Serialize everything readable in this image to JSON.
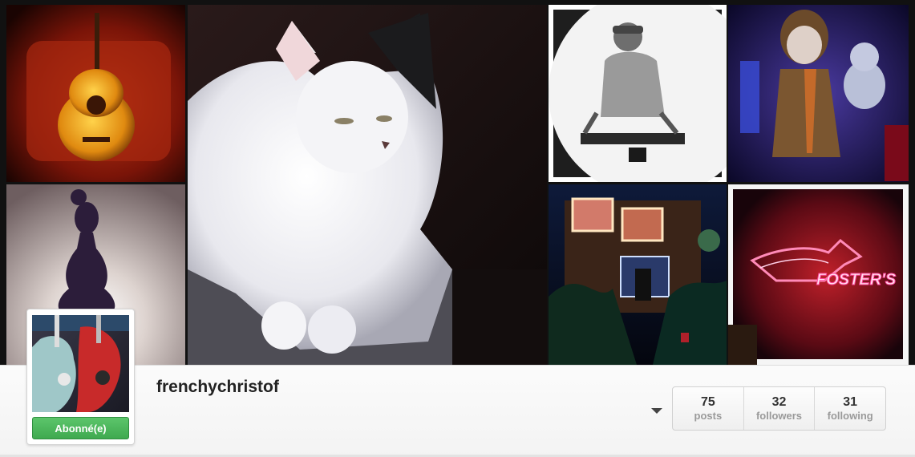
{
  "profile": {
    "username": "frenchychristof",
    "follow_button": "Abonné(e)"
  },
  "stats": [
    {
      "count": "75",
      "label": "posts"
    },
    {
      "count": "32",
      "label": "followers"
    },
    {
      "count": "31",
      "label": "following"
    }
  ],
  "photos": [
    {
      "name": "acoustic guitar"
    },
    {
      "name": "white cat"
    },
    {
      "name": "dj illustration plate"
    },
    {
      "name": "puppet and teddy bear"
    },
    {
      "name": "woman silhouette"
    },
    {
      "name": "christmas house lights"
    },
    {
      "name": "neon sign",
      "sign_text": "FOSTER'S"
    }
  ],
  "icons": {
    "dropdown": "caret-down-icon"
  }
}
